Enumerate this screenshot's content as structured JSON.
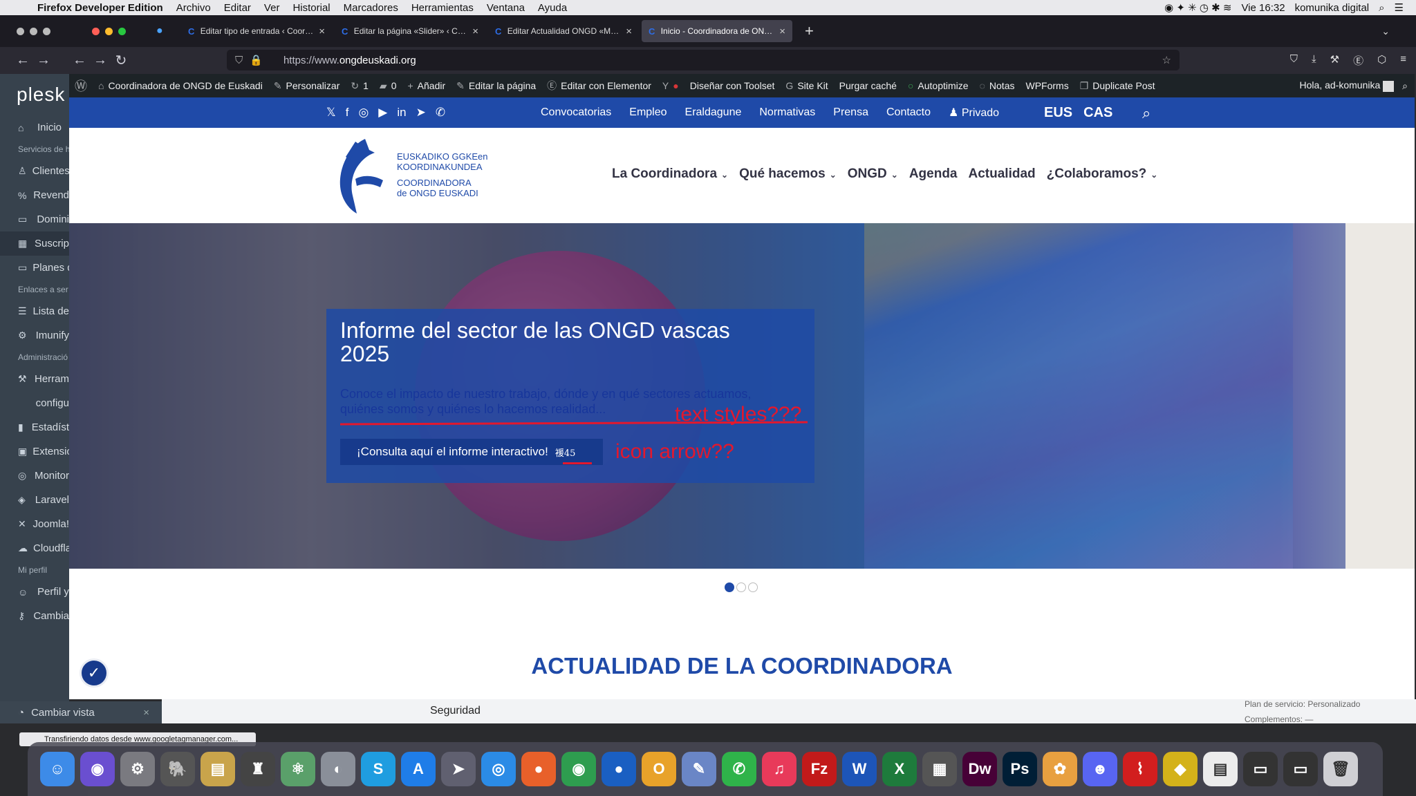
{
  "mac": {
    "app_name": "Firefox Developer Edition",
    "menu": [
      "Archivo",
      "Editar",
      "Ver",
      "Historial",
      "Marcadores",
      "Herramientas",
      "Ventana",
      "Ayuda"
    ],
    "clock": "Vie 16:32",
    "user": "komunika digital"
  },
  "tabs": [
    {
      "title": "Editar tipo de entrada ‹ Coordin"
    },
    {
      "title": "Editar la página «Slider» ‹ Coor"
    },
    {
      "title": "Editar Actualidad ONGD «Misió"
    },
    {
      "title": "Inicio - Coordinadora de ONGD"
    }
  ],
  "address": {
    "prefix": "https://www.",
    "domain": "ongdeuskadi.org"
  },
  "plesk": {
    "logo": "plesk",
    "items": [
      {
        "type": "item",
        "icon": "⌂",
        "label": "Inicio"
      },
      {
        "type": "sec",
        "label": "Servicios de h"
      },
      {
        "type": "item",
        "icon": "♙",
        "label": "Clientes"
      },
      {
        "type": "item",
        "icon": "%",
        "label": "Revend"
      },
      {
        "type": "item",
        "icon": "▭",
        "label": "Domini"
      },
      {
        "type": "item",
        "icon": "▦",
        "label": "Suscrip"
      },
      {
        "type": "item",
        "icon": "▭",
        "label": "Planes d"
      },
      {
        "type": "sec",
        "label": "Enlaces a ser"
      },
      {
        "type": "item",
        "icon": "☰",
        "label": "Lista de"
      },
      {
        "type": "item",
        "icon": "⚙",
        "label": "Imunify"
      },
      {
        "type": "sec",
        "label": "Administració"
      },
      {
        "type": "item",
        "icon": "⚒",
        "label": "Herram"
      },
      {
        "type": "item",
        "icon": "",
        "label": "configu"
      },
      {
        "type": "item",
        "icon": "▮",
        "label": "Estadíst"
      },
      {
        "type": "item",
        "icon": "▣",
        "label": "Extensio"
      },
      {
        "type": "item",
        "icon": "◎",
        "label": "Monitor"
      },
      {
        "type": "item",
        "icon": "◈",
        "label": "Laravel"
      },
      {
        "type": "item",
        "icon": "✕",
        "label": "Joomla!"
      },
      {
        "type": "item",
        "icon": "☁",
        "label": "Cloudfla"
      },
      {
        "type": "sec",
        "label": "Mi perfil"
      },
      {
        "type": "item",
        "icon": "☺",
        "label": "Perfil y"
      },
      {
        "type": "item",
        "icon": "⚷",
        "label": "Cambia"
      }
    ],
    "bottom": "Cambiar vista"
  },
  "wpbar": {
    "site": "Coordinadora de ONGD de Euskadi",
    "personalizar": "Personalizar",
    "updates": "1",
    "comments": "0",
    "add": "Añadir",
    "edit_page": "Editar la página",
    "elementor": "Editar con Elementor",
    "toolset": "Diseñar con Toolset",
    "sitekit": "Site Kit",
    "purge": "Purgar caché",
    "autoptimize": "Autoptimize",
    "notas": "Notas",
    "wpforms": "WPForms",
    "duplicate": "Duplicate Post",
    "greeting": "Hola, ad-komunika"
  },
  "topbar": {
    "links": [
      "Convocatorias",
      "Empleo",
      "Eraldagune",
      "Normativas",
      "Prensa",
      "Contacto",
      "Privado"
    ],
    "langs": [
      "EUS",
      "CAS"
    ]
  },
  "logo": {
    "line1": "EUSKADIKO GGKEen",
    "line2": "KOORDINAKUNDEA",
    "line3": "COORDINADORA",
    "line4": "de ONGD EUSKADI"
  },
  "nav": [
    "La Coordinadora",
    "Qué hacemos",
    "ONGD",
    "Agenda",
    "Actualidad",
    "¿Colaboramos?"
  ],
  "slide": {
    "title": "Informe del sector de las ONGD vascas 2025",
    "subtitle": "Conoce el impacto de nuestro trabajo, dónde y en qué sectores actuamos, quiénes somos y quiénes lo hacemos realidad...",
    "cta": "¡Consulta aquí el informe interactivo!",
    "glyph": "褑45",
    "annotation_text": "text styles???",
    "annotation_icon": "icon arrow??"
  },
  "section_title": "ACTUALIDAD DE LA COORDINADORA",
  "behind": {
    "seguridad": "Seguridad",
    "plan": "Plan de servicio: Personalizado",
    "complementos": "Complementos: —"
  },
  "status": "Transfiriendo datos desde www.googletagmanager.com...",
  "dock": [
    {
      "name": "finder-icon",
      "c": "#3d8be8",
      "t": "☺"
    },
    {
      "name": "siri-icon",
      "c": "#6a4fd0",
      "t": "◉"
    },
    {
      "name": "system-prefs-icon",
      "c": "#7a7a80",
      "t": "⚙"
    },
    {
      "name": "tableplus-icon",
      "c": "#555",
      "t": "🐘"
    },
    {
      "name": "sequel-icon",
      "c": "#c9a44b",
      "t": "▤"
    },
    {
      "name": "db-icon",
      "c": "#444",
      "t": "♜"
    },
    {
      "name": "atom-icon",
      "c": "#5aa06a",
      "t": "⚛"
    },
    {
      "name": "tool-icon",
      "c": "#8a8f99",
      "t": "◐"
    },
    {
      "name": "skype-icon",
      "c": "#1f9de0",
      "t": "S"
    },
    {
      "name": "app-store-icon",
      "c": "#1f7de8",
      "t": "A"
    },
    {
      "name": "launchpad-icon",
      "c": "#606070",
      "t": "➤"
    },
    {
      "name": "safari-icon",
      "c": "#2b8be6",
      "t": "◎"
    },
    {
      "name": "firefox-icon",
      "c": "#e8602a",
      "t": "●"
    },
    {
      "name": "chrome-icon",
      "c": "#2e9d4f",
      "t": "◉"
    },
    {
      "name": "firefox-dev-icon",
      "c": "#1a5fc2",
      "t": "●"
    },
    {
      "name": "opera-icon",
      "c": "#e8a22a",
      "t": "O"
    },
    {
      "name": "preview-icon",
      "c": "#6a86c6",
      "t": "✎"
    },
    {
      "name": "facetime-icon",
      "c": "#2fb34a",
      "t": "✆"
    },
    {
      "name": "music-icon",
      "c": "#e83a5a",
      "t": "♫"
    },
    {
      "name": "filezilla-icon",
      "c": "#c21a1a",
      "t": "Fz"
    },
    {
      "name": "word-icon",
      "c": "#1d55b8",
      "t": "W"
    },
    {
      "name": "excel-icon",
      "c": "#1e7b3c",
      "t": "X"
    },
    {
      "name": "app2-icon",
      "c": "#555",
      "t": "▦"
    },
    {
      "name": "dreamweaver-icon",
      "c": "#470137",
      "t": "Dw"
    },
    {
      "name": "photoshop-icon",
      "c": "#001e36",
      "t": "Ps"
    },
    {
      "name": "photos-icon",
      "c": "#e8a040",
      "t": "✿"
    },
    {
      "name": "discord-icon",
      "c": "#5865f2",
      "t": "☻"
    },
    {
      "name": "acrobat-icon",
      "c": "#d21e1e",
      "t": "⌇"
    },
    {
      "name": "cyberduck-icon",
      "c": "#d4b21a",
      "t": "◆"
    },
    {
      "name": "notes-file-icon",
      "c": "#ececec",
      "t": "▤"
    },
    {
      "name": "window1-icon",
      "c": "#333",
      "t": "▭"
    },
    {
      "name": "window2-icon",
      "c": "#333",
      "t": "▭"
    },
    {
      "name": "trash-icon",
      "c": "#d0d0d4",
      "t": "🗑"
    }
  ]
}
